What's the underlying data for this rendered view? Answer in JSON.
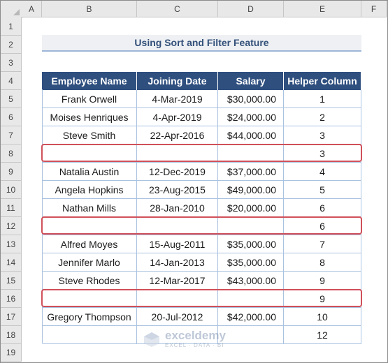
{
  "columns": [
    "A",
    "B",
    "C",
    "D",
    "E",
    "F"
  ],
  "rows": [
    "1",
    "2",
    "3",
    "4",
    "5",
    "6",
    "7",
    "8",
    "9",
    "10",
    "11",
    "12",
    "13",
    "14",
    "15",
    "16",
    "17",
    "18",
    "19"
  ],
  "title": "Using Sort and Filter Feature",
  "table": {
    "headers": [
      "Employee Name",
      "Joining Date",
      "Salary",
      "Helper Column"
    ],
    "rows": [
      [
        "Frank Orwell",
        "4-Mar-2019",
        "$30,000.00",
        "1"
      ],
      [
        "Moises Henriques",
        "4-Apr-2019",
        "$24,000.00",
        "2"
      ],
      [
        "Steve Smith",
        "22-Apr-2016",
        "$44,000.00",
        "3"
      ],
      [
        "",
        "",
        "",
        "3"
      ],
      [
        "Natalia Austin",
        "12-Dec-2019",
        "$37,000.00",
        "4"
      ],
      [
        "Angela Hopkins",
        "23-Aug-2015",
        "$49,000.00",
        "5"
      ],
      [
        "Nathan Mills",
        "28-Jan-2010",
        "$20,000.00",
        "6"
      ],
      [
        "",
        "",
        "",
        "6"
      ],
      [
        "Alfred Moyes",
        "15-Aug-2011",
        "$35,000.00",
        "7"
      ],
      [
        "Jennifer Marlo",
        "14-Jan-2013",
        "$35,000.00",
        "8"
      ],
      [
        "Steve Rhodes",
        "12-Mar-2017",
        "$43,000.00",
        "9"
      ],
      [
        "",
        "",
        "",
        "9"
      ],
      [
        "Gregory Thompson",
        "20-Jul-2012",
        "$42,000.00",
        "10"
      ],
      [
        "",
        "",
        "",
        "12"
      ]
    ]
  },
  "watermark": {
    "name": "exceldemy",
    "tagline": "EXCEL · DATA · BI"
  },
  "colors": {
    "header_bg": "#2f4f7f",
    "highlight": "#d0505a",
    "title_text": "#33507a"
  }
}
